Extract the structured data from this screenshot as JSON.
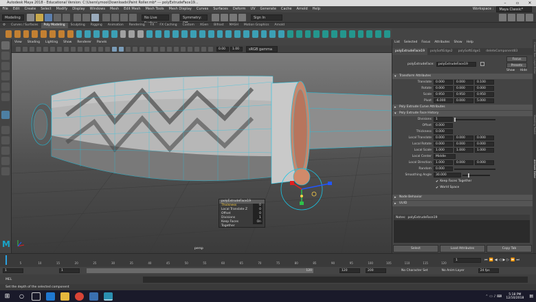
{
  "window": {
    "title": "Autodesk Maya 2018 - Educational Version: C:\\Users\\ymoo\\Downloads\\Paint Roller.mb* --- polyExtrudeFace19...",
    "workspace_label": "Workspace :",
    "workspace_value": "Maya Classic*"
  },
  "menu_items": [
    "File",
    "Edit",
    "Create",
    "Select",
    "Modify",
    "Display",
    "Windows",
    "Mesh",
    "Edit Mesh",
    "Mesh Tools",
    "Mesh Display",
    "Curves",
    "Surfaces",
    "Deform",
    "UV",
    "Generate",
    "Cache",
    "Arnold",
    "Help"
  ],
  "status_line": {
    "mode": "Modeling",
    "live_surface": "No Live Surface",
    "symmetry": "Symmetry: Off",
    "sign_in": "Sign In"
  },
  "shelf_tabs": [
    "Curves / Surfaces",
    "Poly Modeling",
    "Sculpting",
    "Rigging",
    "Animation",
    "Rendering",
    "FX",
    "FX Caching",
    "Custom",
    "XGen",
    "Bifrost",
    "MASH",
    "Motion Graphics",
    "Arnold"
  ],
  "active_shelf_tab": "Poly Modeling",
  "viewport": {
    "menu": [
      "View",
      "Shading",
      "Lighting",
      "Show",
      "Renderer",
      "Panels"
    ],
    "field_a": "0.00",
    "field_b": "1.00",
    "colorspace": "sRGB gamma",
    "camera": "persp"
  },
  "tooltip": {
    "header": "polyExtrudeFace19",
    "rows": [
      {
        "label": "Thickness",
        "value": "0"
      },
      {
        "label": "Local Translate Z",
        "value": "0"
      },
      {
        "label": "Offset",
        "value": "0"
      },
      {
        "label": "Divisions",
        "value": "1"
      },
      {
        "label": "Keep Faces Together",
        "value": "On"
      }
    ]
  },
  "attribute_editor": {
    "menu": [
      "List",
      "Selected",
      "Focus",
      "Attributes",
      "Show",
      "Help"
    ],
    "tabs": [
      "polyExtrudeFace19",
      "polySoftEdge2",
      "polySoftEdge1",
      "deleteComponent83"
    ],
    "node_label": "polyExtrudeFace:",
    "node_value": "polyExtrudeFace19",
    "focus_btn": "Focus",
    "presets_btn": "Presets",
    "show_label": "Show",
    "hide_label": "Hide",
    "transform": {
      "header": "Transform Attributes",
      "rows": [
        {
          "label": "Translate",
          "values": [
            "0.000",
            "0.000",
            "0.100"
          ]
        },
        {
          "label": "Rotate",
          "values": [
            "0.000",
            "0.000",
            "0.000"
          ]
        },
        {
          "label": "Scale",
          "values": [
            "0.950",
            "0.950",
            "0.950"
          ]
        },
        {
          "label": "Pivot",
          "values": [
            "-6.000",
            "0.000",
            "5.000"
          ]
        }
      ]
    },
    "curve_header": "Poly Extrude Curve Attributes",
    "history": {
      "header": "Poly Extrude Face History",
      "divisions": {
        "label": "Divisions",
        "value": "1"
      },
      "offset": {
        "label": "Offset",
        "value": "0.000"
      },
      "thickness": {
        "label": "Thickness",
        "value": "0.000"
      },
      "local_translate": {
        "label": "Local Translate",
        "values": [
          "0.000",
          "0.000",
          "0.000"
        ]
      },
      "local_rotate": {
        "label": "Local Rotate",
        "values": [
          "0.000",
          "0.000",
          "0.000"
        ]
      },
      "local_scale": {
        "label": "Local Scale",
        "values": [
          "1.000",
          "1.000",
          "1.000"
        ]
      },
      "local_center": {
        "label": "Local Center",
        "value": "Middle"
      },
      "local_direction": {
        "label": "Local Direction",
        "values": [
          "1.000",
          "0.000",
          "0.000"
        ]
      },
      "random": {
        "label": "Random",
        "value": "0.000"
      },
      "smoothing": {
        "label": "Smoothing Angle",
        "value": "30.000"
      },
      "keep_faces": "Keep Faces Together",
      "world_space": "World Space"
    },
    "node_behavior": "Node Behavior",
    "uuid": "UUID",
    "notes_label": "Notes:",
    "notes_value": "polyExtrudeFace19",
    "buttons": [
      "Select",
      "Load Attributes",
      "Copy Tab"
    ]
  },
  "timeline": {
    "ticks": [
      "5",
      "10",
      "15",
      "20",
      "25",
      "30",
      "35",
      "40",
      "45",
      "50",
      "55",
      "60",
      "65",
      "70",
      "75",
      "80",
      "85",
      "90",
      "95",
      "100",
      "105",
      "110",
      "115",
      "120"
    ],
    "current": "1"
  },
  "range": {
    "start": "1",
    "start2": "1",
    "slider_end": "120",
    "end": "120",
    "end2": "200",
    "character_set": "No Character Set",
    "anim_layer": "No Anim Layer",
    "fps": "24 fps"
  },
  "command_line": {
    "label": "MEL"
  },
  "help_line": "Set the depth of the selected component",
  "taskbar": {
    "time": "5:18 PM",
    "date": "12/10/2018"
  },
  "side_tabs": [
    "Channel Box / Layer Editor",
    "Modeling Toolkit",
    "Attribute Editor"
  ]
}
